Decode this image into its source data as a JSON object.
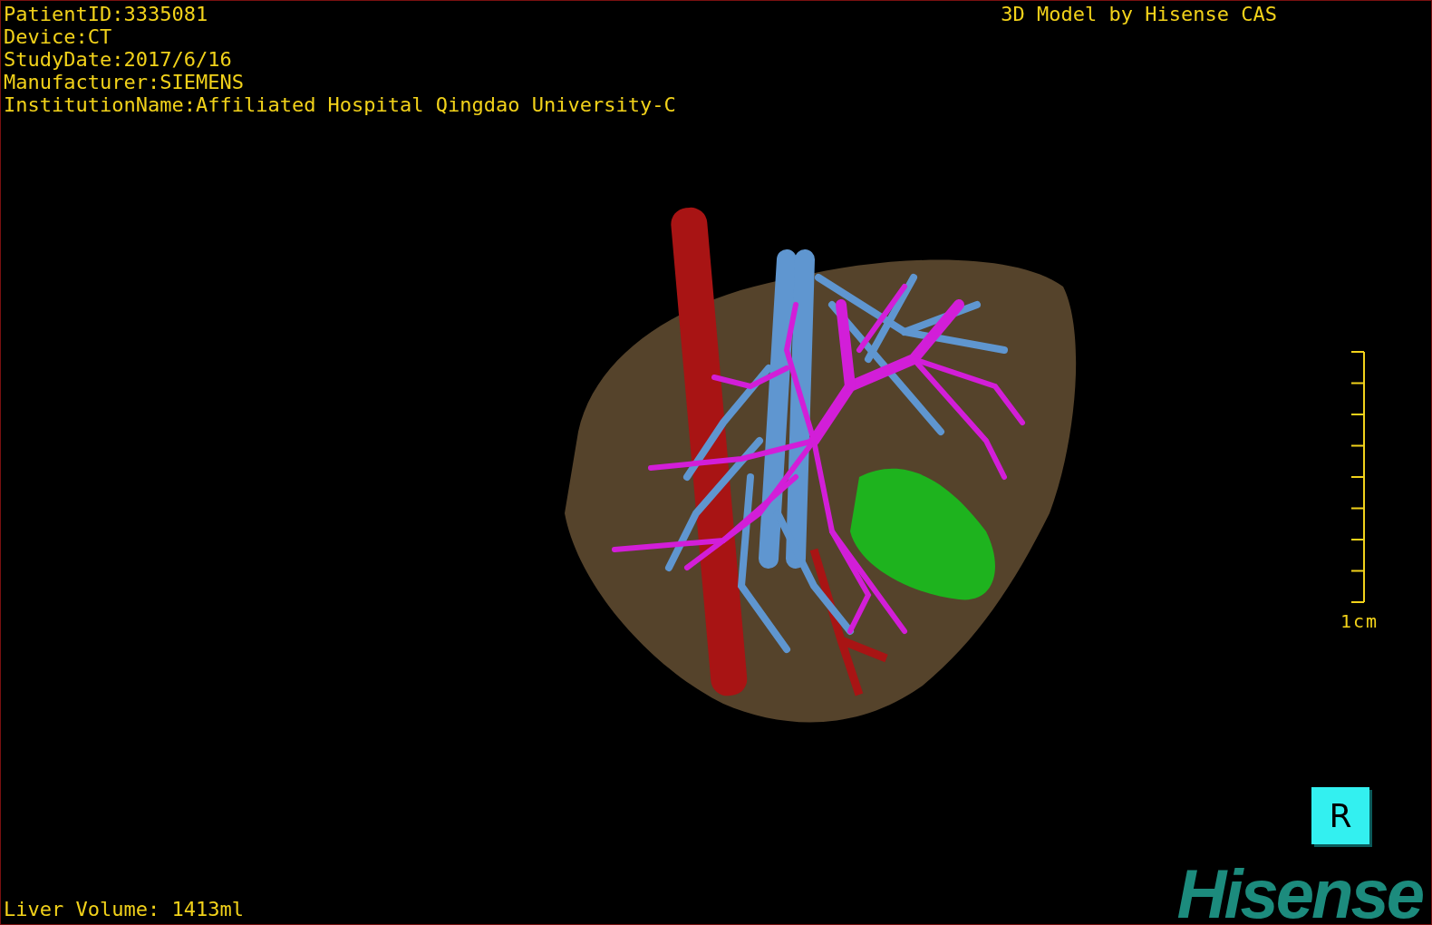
{
  "patient_info": [
    "PatientID:3335081",
    "Device:CT",
    "StudyDate:2017/6/16",
    "Manufacturer:SIEMENS",
    "InstitutionName:Affiliated Hospital Qingdao University-C"
  ],
  "title": "3D Model by Hisense CAS",
  "scale_bar": {
    "label": "1cm"
  },
  "orientation_marker": {
    "label": "R"
  },
  "liver_volume": "Liver Volume: 1413ml",
  "logo": "Hisense"
}
